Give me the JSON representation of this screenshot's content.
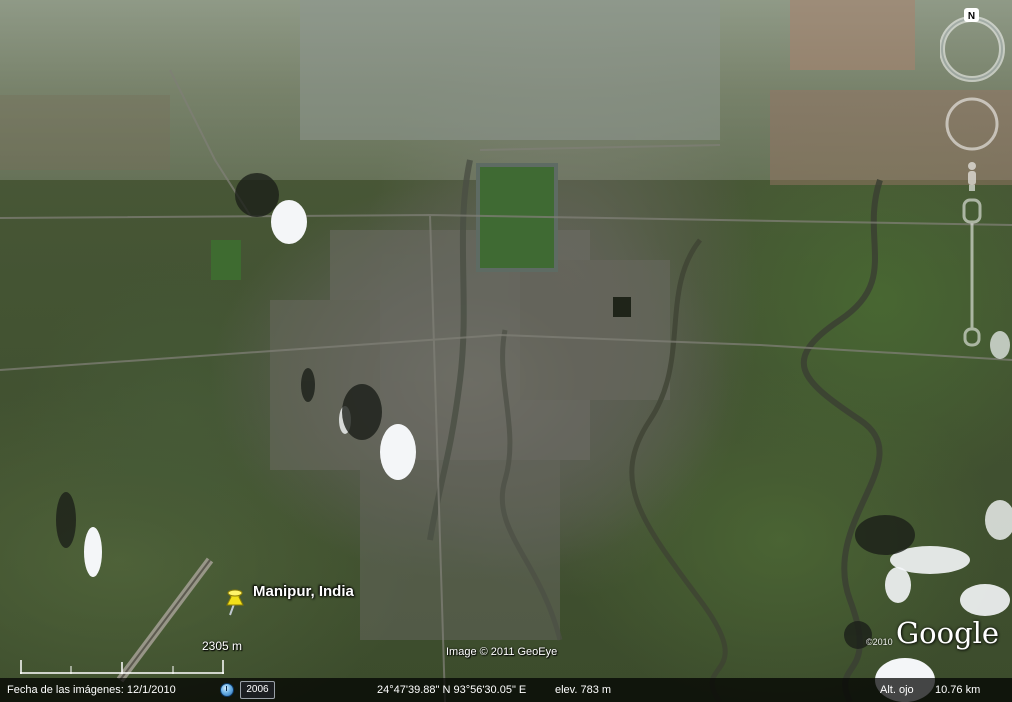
{
  "placemark": {
    "label": "Manipur, India"
  },
  "scale": {
    "distance": "2305 m"
  },
  "attribution": {
    "imagery": "Image © 2011 GeoEye",
    "logo_year": "©2010",
    "logo": "Google"
  },
  "compass": {
    "north_label": "N"
  },
  "status_bar": {
    "imagery_date_label": "Fecha de las imágenes: 12/1/2010",
    "history_year": "2006",
    "coordinates": "24°47'39.88\" N  93°56'30.05\" E",
    "elevation": "elev.  783 m",
    "eye_altitude_label": "Alt. ojo",
    "eye_altitude_value": "10.76 km"
  },
  "colors": {
    "pin": "#f2e019",
    "status_bg": "#000000",
    "text": "#ffffff"
  }
}
